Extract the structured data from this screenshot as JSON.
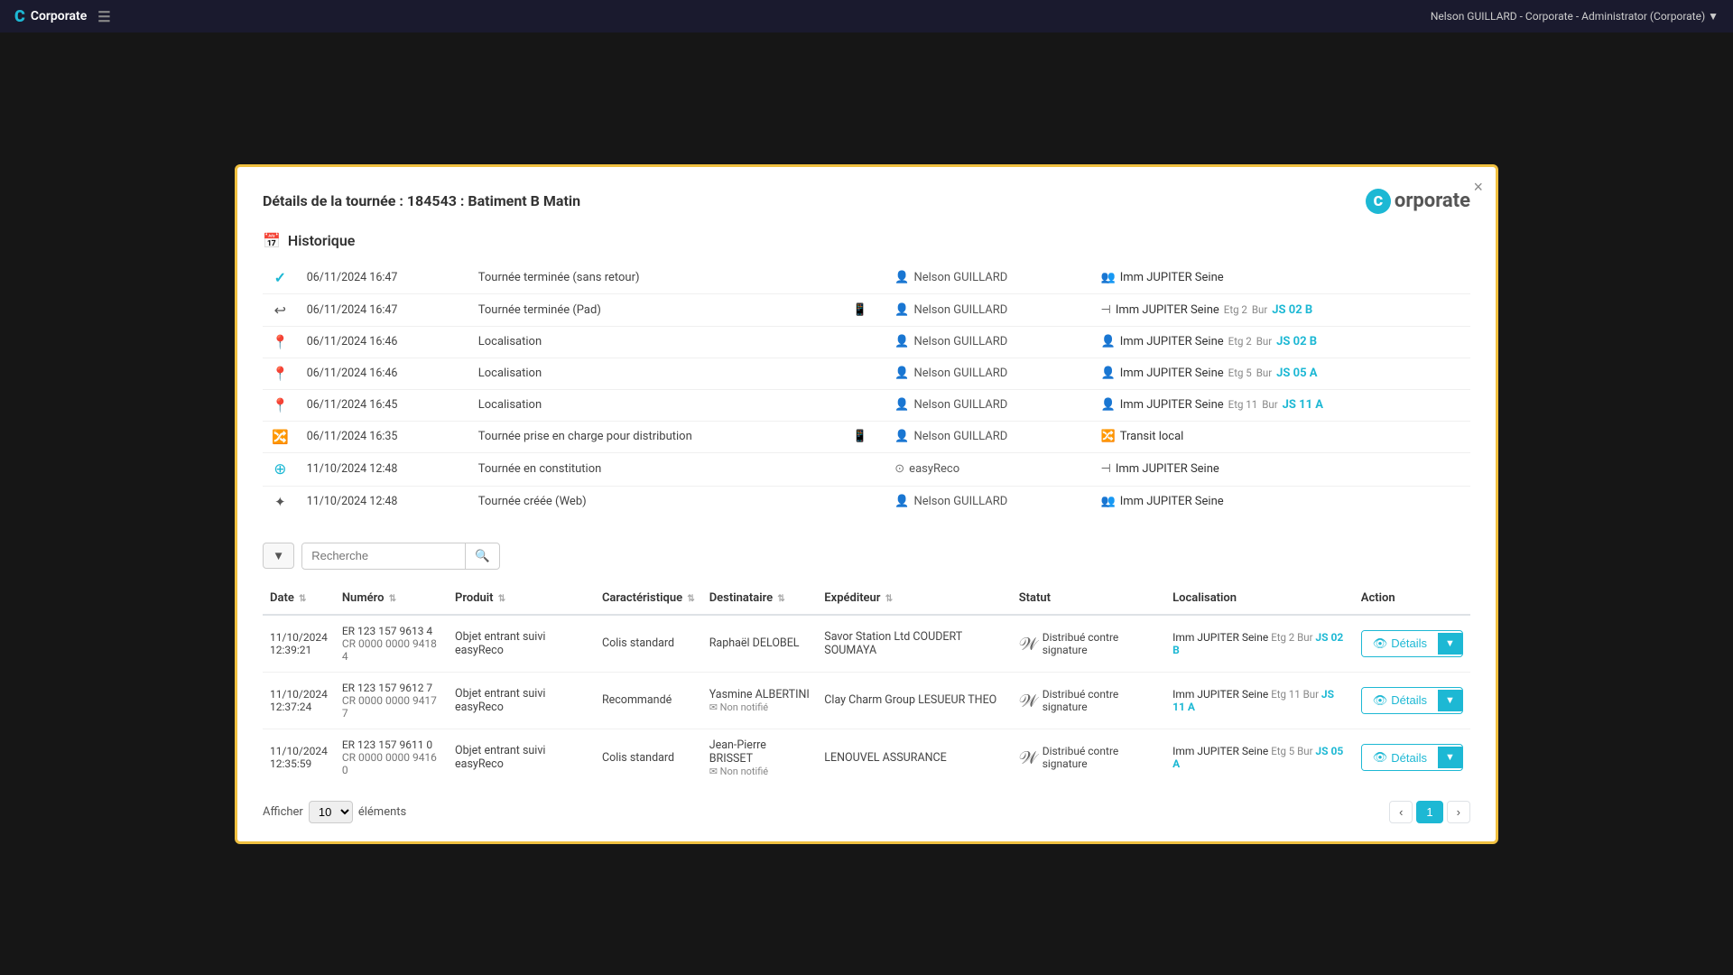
{
  "topbar": {
    "logo": "Corporate",
    "user_info": "Nelson GUILLARD - Corporate - Administrator (Corporate) ▼"
  },
  "modal": {
    "title_prefix": "Détails de la tournée :",
    "title_id": "184543 : Batiment B Matin",
    "logo_text": "orporate",
    "close_label": "×"
  },
  "historique": {
    "section_title": "Historique",
    "rows": [
      {
        "icon": "✓",
        "date": "06/11/2024 16:47",
        "event": "Tournée terminée (sans retour)",
        "device": "",
        "person": "Nelson GUILLARD",
        "location": "Imm JUPITER Seine"
      },
      {
        "icon": "↩",
        "date": "06/11/2024 16:47",
        "event": "Tournée terminée (Pad)",
        "device": "📱",
        "person": "Nelson GUILLARD",
        "location": "Imm JUPITER Seine  Etg 2  Bur JS 02 B"
      },
      {
        "icon": "📍",
        "date": "06/11/2024 16:46",
        "event": "Localisation",
        "device": "",
        "person": "Nelson GUILLARD",
        "location": "Imm JUPITER Seine  Etg 2  Bur JS 02 B"
      },
      {
        "icon": "📍",
        "date": "06/11/2024 16:46",
        "event": "Localisation",
        "device": "",
        "person": "Nelson GUILLARD",
        "location": "Imm JUPITER Seine  Etg 5  Bur JS 05 A"
      },
      {
        "icon": "📍",
        "date": "06/11/2024 16:45",
        "event": "Localisation",
        "device": "",
        "person": "Nelson GUILLARD",
        "location": "Imm JUPITER Seine  Etg 11  Bur JS 11 A"
      },
      {
        "icon": "🔀",
        "date": "06/11/2024 16:35",
        "event": "Tournée prise en charge pour distribution",
        "device": "📱",
        "person": "Nelson GUILLARD",
        "location": "Transit local"
      },
      {
        "icon": "⊕",
        "date": "11/10/2024 12:48",
        "event": "Tournée en constitution",
        "device": "",
        "person": "easyReco",
        "location": "Imm JUPITER Seine"
      },
      {
        "icon": "✦",
        "date": "11/10/2024 12:48",
        "event": "Tournée créée (Web)",
        "device": "",
        "person": "Nelson GUILLARD",
        "location": "Imm JUPITER Seine"
      }
    ]
  },
  "search": {
    "placeholder": "Recherche",
    "filter_icon": "▼",
    "search_icon": "🔍"
  },
  "table": {
    "columns": [
      "Date",
      "Numéro",
      "Produit",
      "Caractéristique",
      "Destinataire",
      "Expéditeur",
      "Statut",
      "Localisation",
      "Action"
    ],
    "rows": [
      {
        "date": "11/10/2024\n12:39:21",
        "numero": "ER 123 157 9613 4\nCR 0000 0000 9418 4",
        "produit": "Objet entrant suivi easyReco",
        "caracteristique": "Colis standard",
        "destinataire": "Raphaël DELOBEL",
        "expediteur": "Savor Station Ltd COUDERT SOUMAYA",
        "statut": "Distribué contre signature",
        "localisation": "Imm JUPITER Seine  Etg 2  Bur JS 02 B",
        "action": "Détails"
      },
      {
        "date": "11/10/2024\n12:37:24",
        "numero": "ER 123 157 9612 7\nCR 0000 0000 9417 7",
        "produit": "Objet entrant suivi easyReco",
        "caracteristique": "Recommandé",
        "destinataire": "Yasmine ALBERTINI\n✉ Non notifié",
        "expediteur": "Clay Charm Group LESUEUR THEO",
        "statut": "Distribué contre signature",
        "localisation": "Imm JUPITER Seine  Etg 11  Bur JS 11 A",
        "action": "Détails"
      },
      {
        "date": "11/10/2024\n12:35:59",
        "numero": "ER 123 157 9611 0\nCR 0000 0000 9416 0",
        "produit": "Objet entrant suivi easyReco",
        "caracteristique": "Colis standard",
        "destinataire": "Jean-Pierre BRISSET\n✉ Non notifié",
        "expediteur": "LENOUVEL ASSURANCE",
        "statut": "Distribué contre signature",
        "localisation": "Imm JUPITER Seine  Etg 5  Bur JS 05 A",
        "action": "Détails"
      }
    ]
  },
  "pagination": {
    "show_label": "Afficher",
    "elements_label": "éléments",
    "per_page": "10",
    "current_page": 1,
    "prev_icon": "‹",
    "next_icon": "›"
  }
}
